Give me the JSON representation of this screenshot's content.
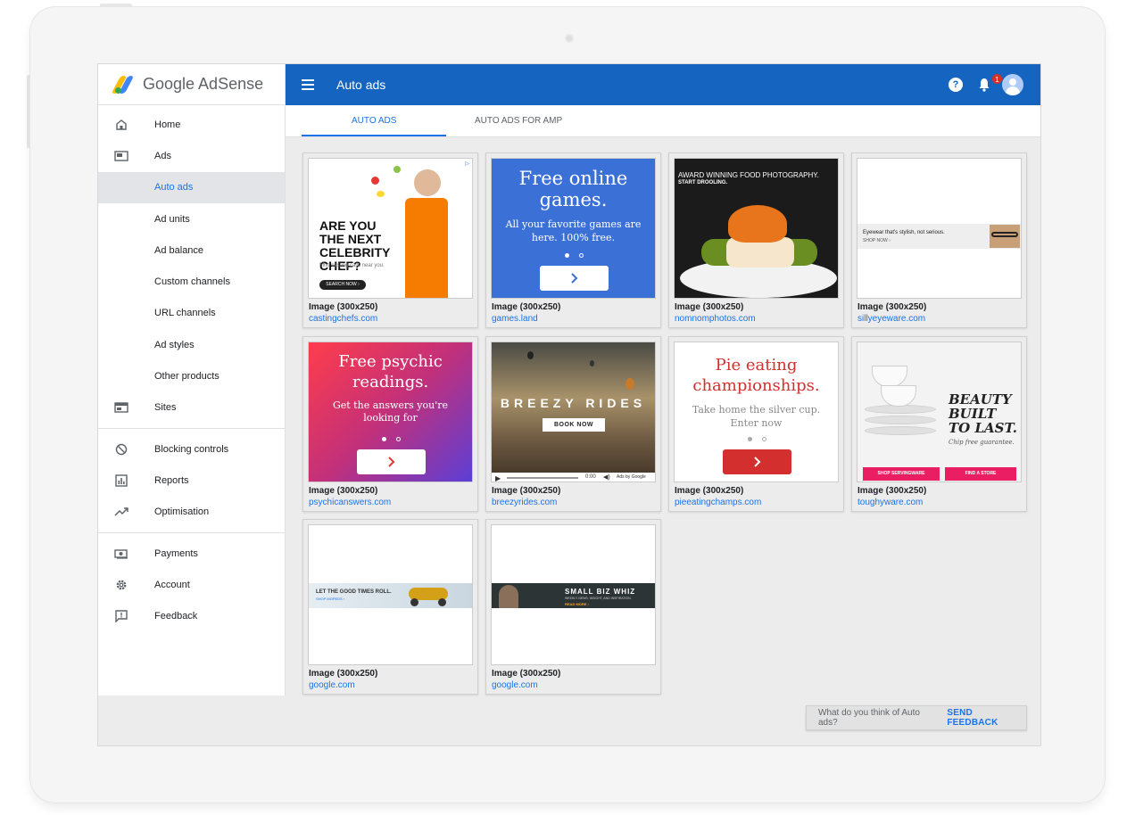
{
  "app": {
    "brand": "Google AdSense",
    "page_title": "Auto ads"
  },
  "header": {
    "help_label": "?",
    "notification_count": "1"
  },
  "tabs": [
    {
      "label": "AUTO ADS",
      "active": true
    },
    {
      "label": "AUTO ADS FOR AMP",
      "active": false
    }
  ],
  "sidebar": {
    "items": [
      {
        "label": "Home",
        "icon": "home-icon"
      },
      {
        "label": "Ads",
        "icon": "ads-icon"
      },
      {
        "label": "Auto ads",
        "active": true
      },
      {
        "label": "Ad units"
      },
      {
        "label": "Ad balance"
      },
      {
        "label": "Custom channels"
      },
      {
        "label": "URL channels"
      },
      {
        "label": "Ad styles"
      },
      {
        "label": "Other products"
      },
      {
        "label": "Sites",
        "icon": "sites-icon"
      },
      {
        "label": "Blocking controls",
        "icon": "block-icon"
      },
      {
        "label": "Reports",
        "icon": "reports-icon"
      },
      {
        "label": "Optimisation",
        "icon": "trending-icon"
      },
      {
        "label": "Payments",
        "icon": "payments-icon"
      },
      {
        "label": "Account",
        "icon": "gear-icon"
      },
      {
        "label": "Feedback",
        "icon": "feedback-icon"
      }
    ]
  },
  "ads": [
    {
      "caption": "Image (300x250)",
      "domain": "castingchefs.com",
      "headline": "ARE YOU THE NEXT CELEBRITY CHEF?",
      "sub": "Find casting calls near you.",
      "cta": "SEARCH NOW ›"
    },
    {
      "caption": "Image (300x250)",
      "domain": "games.land",
      "headline": "Free online games.",
      "sub": "All your favorite games are here. 100% free."
    },
    {
      "caption": "Image (300x250)",
      "domain": "nomnomphotos.com",
      "headline": "AWARD WINNING FOOD PHOTOGRAPHY.",
      "sub": "START DROOLING."
    },
    {
      "caption": "Image (300x250)",
      "domain": "sillyeyeware.com",
      "headline": "Eyewear that's stylish, not serious.",
      "sub": "SHOP NOW ›"
    },
    {
      "caption": "Image (300x250)",
      "domain": "psychicanswers.com",
      "headline": "Free psychic readings.",
      "sub": "Get the answers you're looking for"
    },
    {
      "caption": "Image (300x250)",
      "domain": "breezyrides.com",
      "headline": "BREEZY RIDES",
      "cta": "BOOK NOW",
      "time": "0:00",
      "adsby": "Ads by Google"
    },
    {
      "caption": "Image (300x250)",
      "domain": "pieeatingchamps.com",
      "headline": "Pie eating championships.",
      "sub": "Take home the silver cup. Enter now"
    },
    {
      "caption": "Image (300x250)",
      "domain": "toughyware.com",
      "headline": "BEAUTY BUILT TO LAST.",
      "sub": "Chip free guarantee.",
      "cta1": "SHOP SERVINGWARE",
      "cta2": "FIND A STORE"
    },
    {
      "caption": "Image (300x250)",
      "domain": "google.com",
      "headline": "LET THE GOOD TIMES ROLL.",
      "sub": "SHOP MOPEDS ›"
    },
    {
      "caption": "Image (300x250)",
      "domain": "google.com",
      "headline": "SMALL BIZ WHIZ",
      "sub": "WEEKLY NEWS, INSIGHT, AND INSPIRATION.",
      "cta": "READ MORE ›"
    }
  ],
  "feedback": {
    "question": "What do you think of Auto ads?",
    "action": "SEND FEEDBACK"
  },
  "colors": {
    "header": "#1565c0",
    "accent": "#1a73e8",
    "games_bg": "#3b71d6",
    "pie_red": "#d32f2f",
    "tough_pink": "#e91e63"
  }
}
